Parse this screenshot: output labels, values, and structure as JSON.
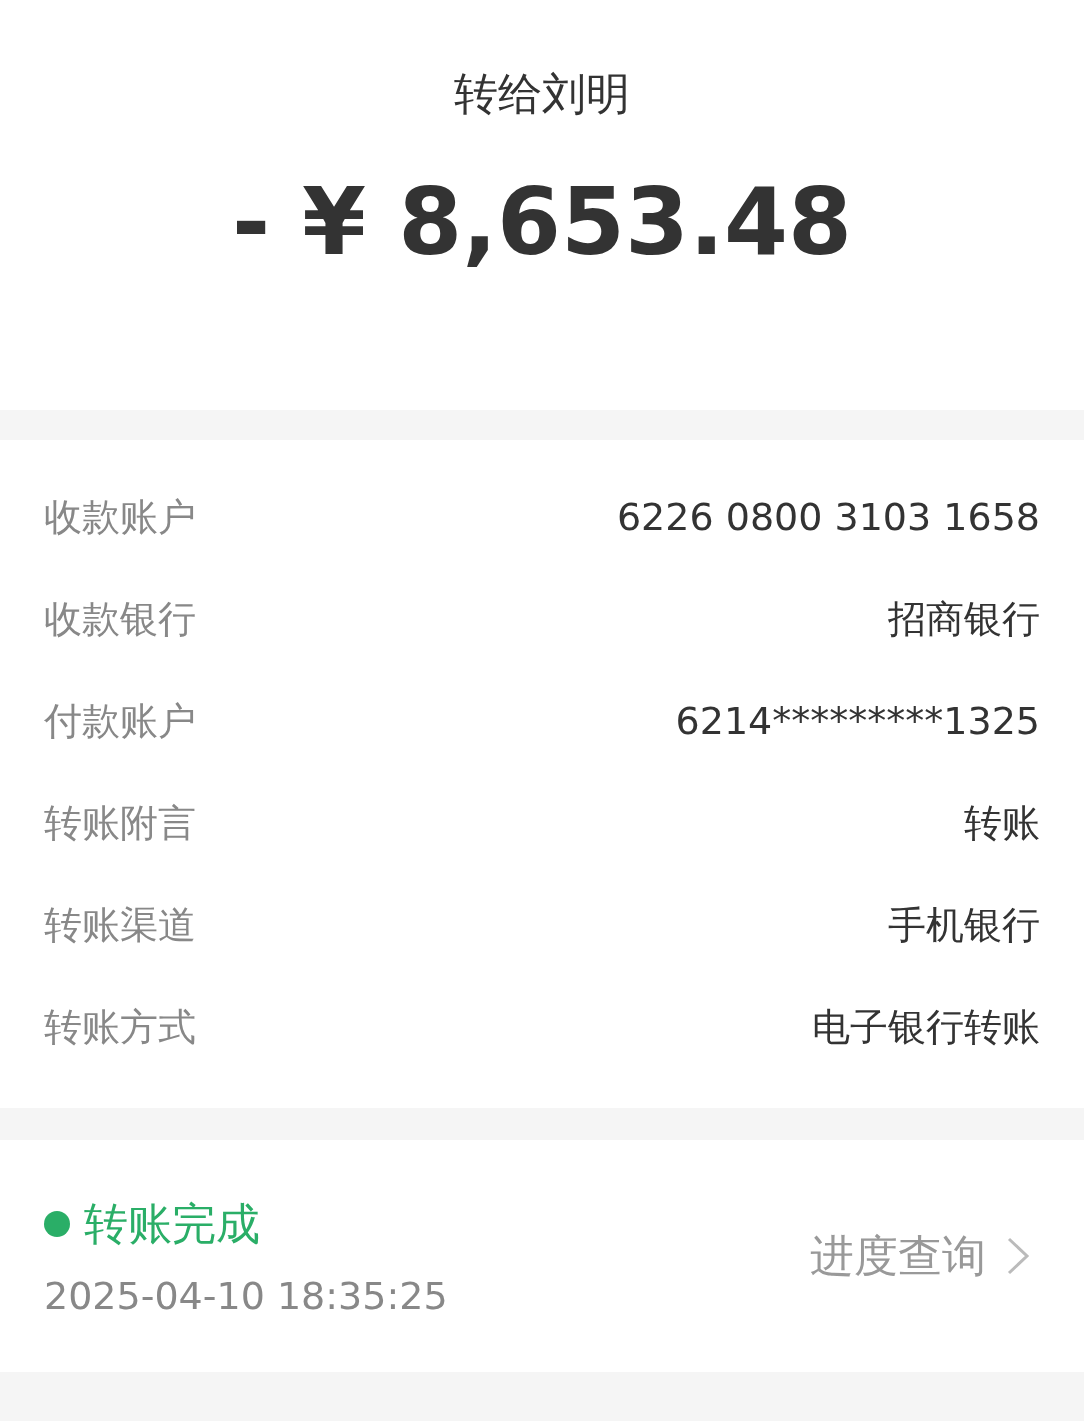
{
  "header": {
    "title": "转给刘明",
    "amount": "- ¥ 8,653.48"
  },
  "details": [
    {
      "label": "收款账户",
      "value": "6226 0800 3103 1658"
    },
    {
      "label": "收款银行",
      "value": "招商银行"
    },
    {
      "label": "付款账户",
      "value": "6214*********1325"
    },
    {
      "label": "转账附言",
      "value": "转账"
    },
    {
      "label": "转账渠道",
      "value": "手机银行"
    },
    {
      "label": "转账方式",
      "value": "电子银行转账"
    }
  ],
  "status": {
    "text": "转账完成",
    "time": "2025-04-10 18:35:25",
    "link": "进度查询"
  }
}
